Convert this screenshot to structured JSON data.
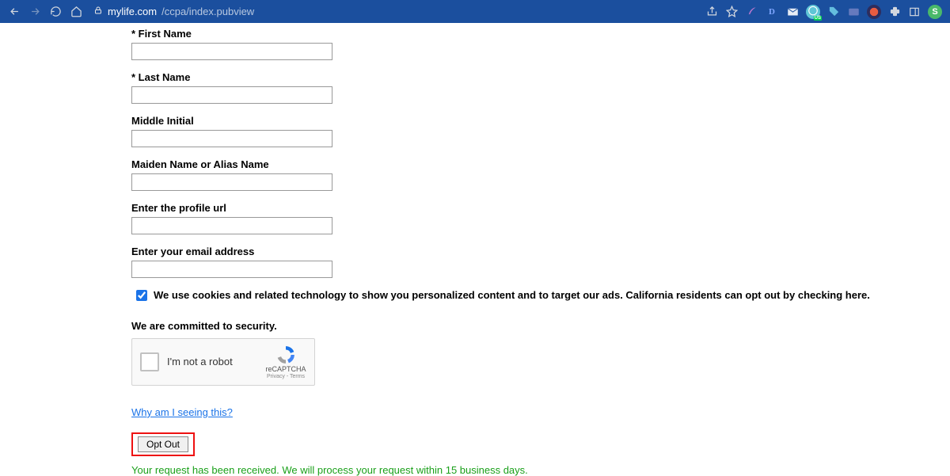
{
  "browser": {
    "url_host": "mylife.com",
    "url_path": "/ccpa/index.pubview",
    "profile_letter": "S"
  },
  "form": {
    "first_name_label": "* First Name",
    "first_name_value": "",
    "last_name_label": "* Last Name",
    "last_name_value": "",
    "middle_initial_label": "Middle Initial",
    "middle_initial_value": "",
    "maiden_label": "Maiden Name or Alias Name",
    "maiden_value": "",
    "profile_url_label": "Enter the profile url",
    "profile_url_value": "",
    "email_label": "Enter your email address",
    "email_value": "",
    "cookie_text": "We use cookies and related technology to show you personalized content and to target our ads. California residents can opt out by checking here.",
    "cookie_checked": true,
    "security_title": "We are committed to security.",
    "recaptcha_label": "I'm not a robot",
    "recaptcha_brand": "reCAPTCHA",
    "recaptcha_terms": "Privacy - Terms",
    "why_link": "Why am I seeing this?",
    "optout_button": "Opt Out",
    "confirmation": "Your request has been received. We will process your request within 15 business days."
  }
}
